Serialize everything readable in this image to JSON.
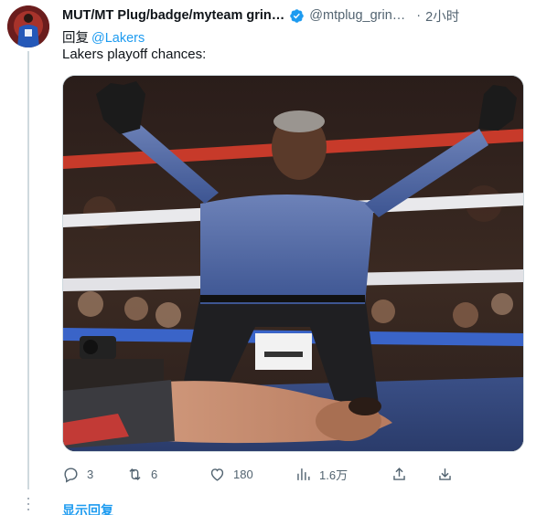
{
  "author": {
    "display_name": "MUT/MT Plug/badge/myteam grin…",
    "handle": "@mtplug_grin…",
    "time": "2小时",
    "verified": true
  },
  "reply": {
    "prefix": "回复",
    "mention": "@Lakers"
  },
  "text": "Lakers playoff chances:",
  "media": {
    "icon": "photo-boxing-referee-knockout"
  },
  "actions": {
    "replies": "3",
    "retweets": "6",
    "likes": "180",
    "views": "1.6万"
  },
  "show_replies": "显示回复",
  "colors": {
    "accent": "#1d9bf0",
    "muted": "#536471",
    "text": "#0f1419",
    "border": "#cfd9de"
  }
}
